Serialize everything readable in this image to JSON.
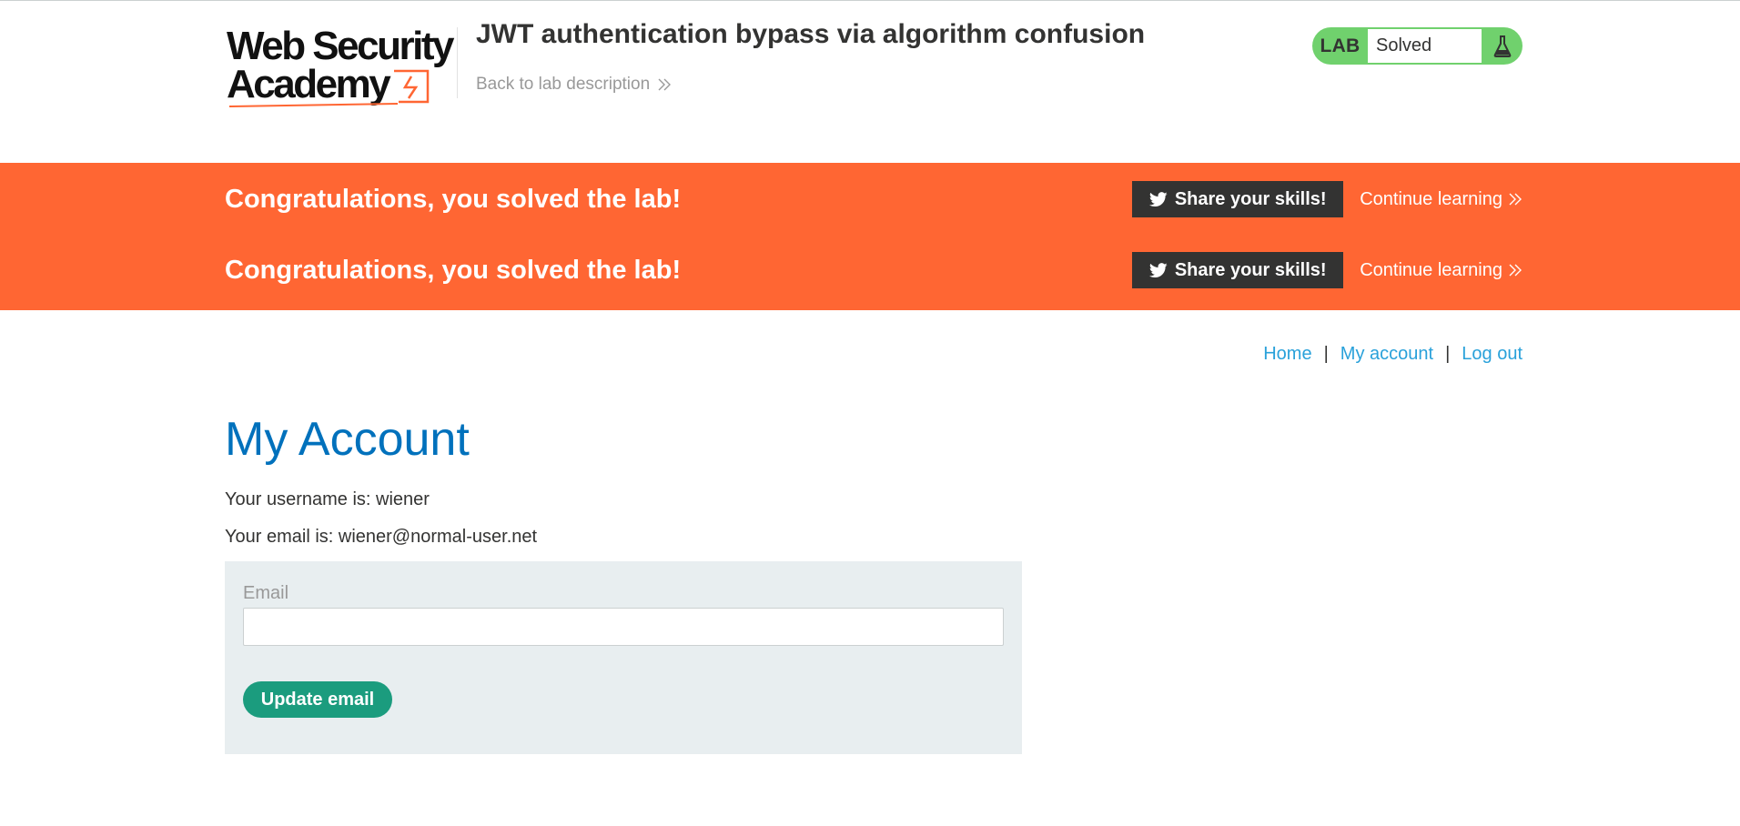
{
  "header": {
    "logo_text": "Web Security Academy",
    "lab_title": "JWT authentication bypass via algorithm confusion",
    "back_link_label": "Back to lab description",
    "status": {
      "tag": "LAB",
      "value": "Solved",
      "icon": "flask-icon"
    }
  },
  "notifications": [
    {
      "message": "Congratulations, you solved the lab!",
      "share_label": "Share your skills!",
      "share_icon": "twitter-icon",
      "continue_label": "Continue learning"
    },
    {
      "message": "Congratulations, you solved the lab!",
      "share_label": "Share your skills!",
      "share_icon": "twitter-icon",
      "continue_label": "Continue learning"
    }
  ],
  "nav": {
    "links": [
      "Home",
      "My account",
      "Log out"
    ],
    "separator": "|"
  },
  "main": {
    "title": "My Account",
    "username_line": "Your username is: wiener",
    "email_line": "Your email is: wiener@normal-user.net",
    "form": {
      "email_label": "Email",
      "email_value": "",
      "submit_label": "Update email"
    }
  },
  "colors": {
    "accent_orange": "#ff6633",
    "lab_status_green": "#70d16d",
    "heading_blue": "#0071bc",
    "link_blue": "#29a1da",
    "button_green": "#1b9c7e",
    "dark_button": "#333332",
    "form_background": "#e8eef0"
  }
}
